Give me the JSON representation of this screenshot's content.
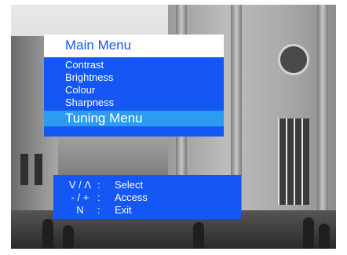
{
  "menu": {
    "title": "Main Menu",
    "items": [
      {
        "label": "Contrast"
      },
      {
        "label": "Brightness"
      },
      {
        "label": "Colour"
      },
      {
        "label": "Sharpness"
      },
      {
        "label": "Tuning Menu",
        "selected": true
      }
    ]
  },
  "help": {
    "rows": [
      {
        "key": "V / Λ",
        "sep": ":",
        "action": "Select"
      },
      {
        "key": "- / +",
        "sep": ":",
        "action": "Access"
      },
      {
        "key": "N",
        "sep": ":",
        "action": "Exit"
      }
    ]
  },
  "colors": {
    "menu_background": "#1457f5",
    "selected_item": "#2b9cf2",
    "title_background": "#ffffff",
    "title_text": "#1457f5"
  },
  "icons": {
    "background": "grayscale-street-photo"
  }
}
